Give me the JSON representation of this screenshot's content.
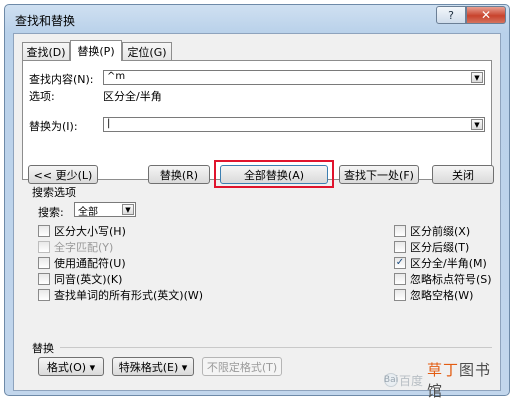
{
  "window": {
    "title": "查找和替换",
    "help_label": "?",
    "close_label": "✕"
  },
  "tabs": [
    {
      "label": "查找(D)",
      "active": false
    },
    {
      "label": "替换(P)",
      "active": true
    },
    {
      "label": "定位(G)",
      "active": false
    }
  ],
  "find": {
    "label": "查找内容(N):",
    "value": "^m",
    "options_label": "选项:",
    "options_value": "区分全/半角"
  },
  "replace": {
    "label": "替换为(I):",
    "value": "|"
  },
  "buttons": {
    "less": "<< 更少(L)",
    "replace": "替换(R)",
    "replace_all": "全部替换(A)",
    "find_next": "查找下一处(F)",
    "close": "关闭"
  },
  "search_options": {
    "header": "搜索选项",
    "search_label": "搜索:",
    "search_value": "全部",
    "left": [
      {
        "label": "区分大小写(H)",
        "checked": false,
        "enabled": true
      },
      {
        "label": "全字匹配(Y)",
        "checked": false,
        "enabled": false
      },
      {
        "label": "使用通配符(U)",
        "checked": false,
        "enabled": true
      },
      {
        "label": "同音(英文)(K)",
        "checked": false,
        "enabled": true
      },
      {
        "label": "查找单词的所有形式(英文)(W)",
        "checked": false,
        "enabled": true
      }
    ],
    "right": [
      {
        "label": "区分前缀(X)",
        "checked": false,
        "enabled": true
      },
      {
        "label": "区分后缀(T)",
        "checked": false,
        "enabled": true
      },
      {
        "label": "区分全/半角(M)",
        "checked": true,
        "enabled": true
      },
      {
        "label": "忽略标点符号(S)",
        "checked": false,
        "enabled": true
      },
      {
        "label": "忽略空格(W)",
        "checked": false,
        "enabled": true
      }
    ]
  },
  "replace_section": {
    "header": "替换",
    "format": "格式(O) ▾",
    "special": "特殊格式(E) ▾",
    "no_format": "不限定格式(T)"
  },
  "watermark": {
    "icon": "Bai",
    "brand_a": "百",
    "brand_b": "度",
    "text_hl": "草丁",
    "text_rest": "图书馆"
  }
}
